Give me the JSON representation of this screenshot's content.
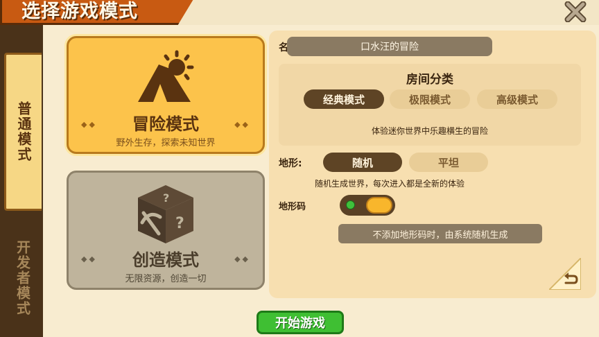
{
  "title": "选择游戏模式",
  "sidebar": {
    "tabs": [
      {
        "label": "普通模式",
        "selected": true
      },
      {
        "label": "开发者模式",
        "selected": false
      }
    ]
  },
  "modes": [
    {
      "title": "冒险模式",
      "desc": "野外生存，探索未知世界",
      "icon": "tent-sun-icon",
      "selected": true
    },
    {
      "title": "创造模式",
      "desc": "无限资源，创造一切",
      "icon": "mystery-box-icon",
      "selected": false
    }
  ],
  "name": {
    "label": "名称:",
    "value": "口水汪的冒险"
  },
  "room": {
    "title": "房间分类",
    "options": [
      "经典模式",
      "极限模式",
      "高级模式"
    ],
    "selected": "经典模式",
    "desc": "体验迷你世界中乐趣横生的冒险"
  },
  "terrain": {
    "label": "地形:",
    "options": [
      "随机",
      "平坦"
    ],
    "selected": "随机",
    "desc": "随机生成世界，每次进入都是全新的体验"
  },
  "seed": {
    "label": "地形码",
    "toggle_on": true,
    "placeholder": "不添加地形码时，由系统随机生成"
  },
  "start_label": "开始游戏",
  "colors": {
    "accent": "#fcc34b",
    "start": "#3fbf33",
    "banner": "#c85a12"
  }
}
